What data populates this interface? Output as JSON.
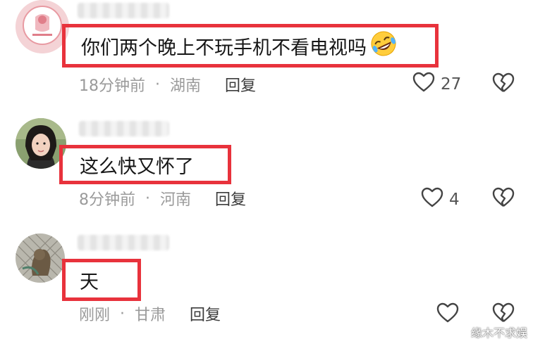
{
  "comments": [
    {
      "text": "你们两个晚上不玩手机不看电视吗",
      "emoji": "rofl-emoji",
      "time": "18分钟前",
      "location": "湖南",
      "reply_label": "回复",
      "like_count": "27"
    },
    {
      "text": "这么快又怀了",
      "time": "8分钟前",
      "location": "河南",
      "reply_label": "回复",
      "like_count": "4"
    },
    {
      "text": "天",
      "time": "刚刚",
      "location": "甘肃",
      "reply_label": "回复",
      "like_count": ""
    }
  ],
  "separator": "·",
  "watermark": "缘木不求娱",
  "colors": {
    "highlight_box": "#e8323c",
    "meta_text": "#9a9a9a",
    "reply_text": "#3c3c3c"
  },
  "icons": [
    "heart-outline-icon",
    "broken-heart-icon"
  ]
}
